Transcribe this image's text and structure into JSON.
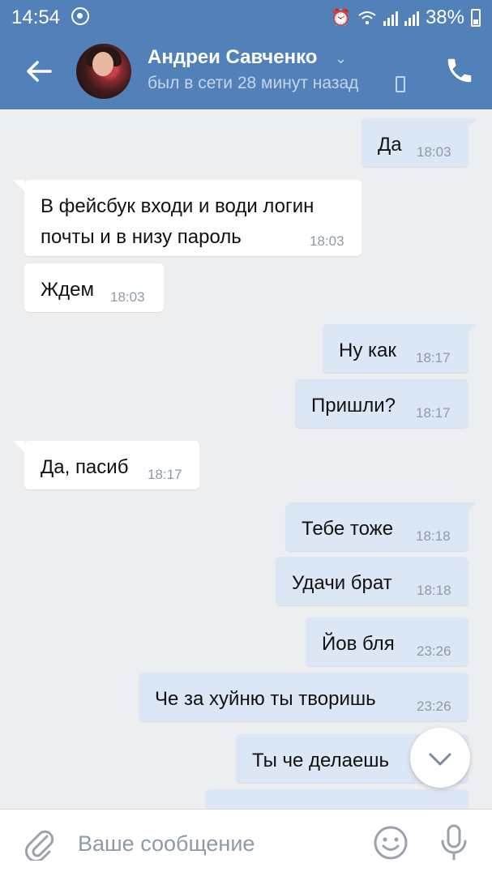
{
  "status_bar": {
    "time": "14:54",
    "battery": "38%"
  },
  "header": {
    "contact_name": "Андреи Савченко",
    "last_seen": "был в сети 28 минут назад"
  },
  "messages": [
    {
      "dir": "out",
      "text": "Да",
      "time": "18:03"
    },
    {
      "dir": "in",
      "text": "В фейсбук входи и води логин\nпочты и в низу пароль",
      "time": "18:03"
    },
    {
      "dir": "in",
      "text": "Ждем",
      "time": "18:03"
    },
    {
      "dir": "out",
      "text": "Ну как",
      "time": "18:17"
    },
    {
      "dir": "out",
      "text": "Пришли?",
      "time": "18:17"
    },
    {
      "dir": "in",
      "text": "Да, пасиб",
      "time": "18:17"
    },
    {
      "dir": "out",
      "text": "Тебе тоже",
      "time": "18:18"
    },
    {
      "dir": "out",
      "text": "Удачи брат",
      "time": "18:18"
    },
    {
      "dir": "out",
      "text": "Йов бля",
      "time": "23:26"
    },
    {
      "dir": "out",
      "text": "Че за хуйню ты творишь",
      "time": "23:26"
    },
    {
      "dir": "out",
      "text": "Ты че делаешь",
      "time": ""
    }
  ],
  "composer": {
    "placeholder": "Ваше сообщение"
  },
  "icons": {
    "back": "arrow-left-icon",
    "call": "phone-icon",
    "attach": "paperclip-icon",
    "emoji": "smiley-icon",
    "mic": "microphone-icon",
    "scroll": "chevron-down-icon"
  },
  "colors": {
    "header": "#5181b8",
    "outgoing": "#dce7f5",
    "incoming": "#ffffff",
    "background": "#edeef0"
  }
}
